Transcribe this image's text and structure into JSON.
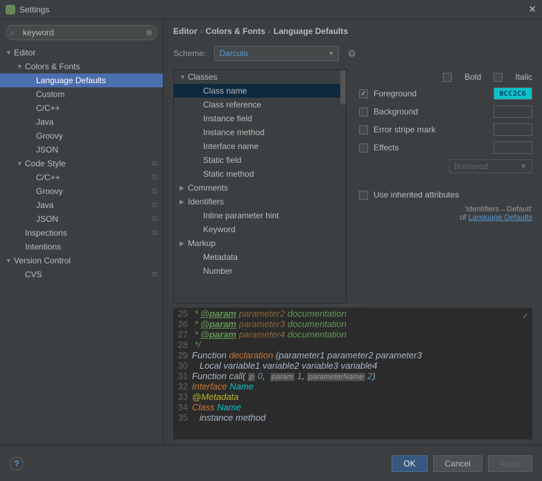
{
  "window": {
    "title": "Settings"
  },
  "search": {
    "value": "keyword"
  },
  "sidebar": {
    "items": [
      {
        "label": "Editor",
        "arrow": "▼",
        "indent": 0
      },
      {
        "label": "Colors & Fonts",
        "arrow": "▼",
        "indent": 1
      },
      {
        "label": "Language Defaults",
        "arrow": "",
        "indent": 2,
        "selected": true
      },
      {
        "label": "Custom",
        "arrow": "",
        "indent": 2
      },
      {
        "label": "C/C++",
        "arrow": "",
        "indent": 2
      },
      {
        "label": "Java",
        "arrow": "",
        "indent": 2
      },
      {
        "label": "Groovy",
        "arrow": "",
        "indent": 2
      },
      {
        "label": "JSON",
        "arrow": "",
        "indent": 2
      },
      {
        "label": "Code Style",
        "arrow": "▼",
        "indent": 1,
        "ext": "⧉"
      },
      {
        "label": "C/C++",
        "arrow": "",
        "indent": 2,
        "ext": "⧉"
      },
      {
        "label": "Groovy",
        "arrow": "",
        "indent": 2,
        "ext": "⧉"
      },
      {
        "label": "Java",
        "arrow": "",
        "indent": 2,
        "ext": "⧉"
      },
      {
        "label": "JSON",
        "arrow": "",
        "indent": 2,
        "ext": "⧉"
      },
      {
        "label": "Inspections",
        "arrow": "",
        "indent": 1,
        "ext": "⧉"
      },
      {
        "label": "Intentions",
        "arrow": "",
        "indent": 1
      },
      {
        "label": "Version Control",
        "arrow": "▼",
        "indent": 0
      },
      {
        "label": "CVS",
        "arrow": "",
        "indent": 1,
        "ext": "⧉"
      }
    ]
  },
  "breadcrumb": {
    "a": "Editor",
    "b": "Colors & Fonts",
    "c": "Language Defaults"
  },
  "scheme": {
    "label": "Scheme:",
    "value": "Darcula"
  },
  "attrs": {
    "items": [
      {
        "label": "Classes",
        "arrow": "▼"
      },
      {
        "label": "Class name",
        "sub": true,
        "sel": true
      },
      {
        "label": "Class reference",
        "sub": true
      },
      {
        "label": "Instance field",
        "sub": true
      },
      {
        "label": "Instance method",
        "sub": true
      },
      {
        "label": "Interface name",
        "sub": true
      },
      {
        "label": "Static field",
        "sub": true
      },
      {
        "label": "Static method",
        "sub": true
      },
      {
        "label": "Comments",
        "arrow": "▶"
      },
      {
        "label": "Identifiers",
        "arrow": "▶"
      },
      {
        "label": "Inline parameter hint",
        "sub": true
      },
      {
        "label": "Keyword",
        "sub": true
      },
      {
        "label": "Markup",
        "arrow": "▶"
      },
      {
        "label": "Metadata",
        "sub": true
      },
      {
        "label": "Number",
        "sub": true
      }
    ]
  },
  "props": {
    "bold": "Bold",
    "italic": "Italic",
    "foreground": "Foreground",
    "fg_value": "0CC2C6",
    "background": "Background",
    "errorstripe": "Error stripe mark",
    "effects": "Effects",
    "bordered": "Bordered",
    "useInherited": "Use inherited attributes",
    "inheritPath": "'Identifiers→Default'",
    "inheritOf": "of ",
    "inheritLink": "Language Defaults"
  },
  "preview": {
    "lines": [
      {
        "n": "25",
        "html": " * <span class='doctag'>@param</span> <span class='docparam'>parameter2</span> <span class='doc'>documentation</span>"
      },
      {
        "n": "26",
        "html": " * <span class='doctag'>@param</span> <span class='docparam'>parameter3</span> <span class='doc'>documentation</span>"
      },
      {
        "n": "27",
        "html": " * <span class='doctag'>@param</span> <span class='docparam'>parameter4</span> <span class='doc'>documentation</span>"
      },
      {
        "n": "28",
        "html": " */"
      },
      {
        "n": "29",
        "html": "<span class='txt'>Function </span><span class='kw'>declaration</span><span class='txt'> (parameter1 parameter2 parameter3</span>"
      },
      {
        "n": "30",
        "html": "<span class='txt'>   Local variable1 variable2 variable3 variable4</span>"
      },
      {
        "n": "31",
        "html": "<span class='txt'>Function call( </span><span class='paramname-bg'>p</span><span class='txt'> </span><span class='num'>0</span><span class='txt'>,  </span><span class='paramname-bg'>param</span><span class='txt'> </span><span class='num'>1</span><span class='txt'>, </span><span class='paramname-bg'>parameterName</span><span class='txt'> </span><span class='num'>2</span><span class='txt'>)</span>"
      },
      {
        "n": "32",
        "html": "<span class='kw'>Interface</span> <span class='cls'>Name</span>"
      },
      {
        "n": "33",
        "html": "<span class='meta'>@Metadata</span>"
      },
      {
        "n": "34",
        "html": "<span class='kw'>Class</span> <span class='cls'>Name</span>"
      },
      {
        "n": "35",
        "html": "<span class='txt'>   instance method</span>"
      }
    ]
  },
  "footer": {
    "ok": "OK",
    "cancel": "Cancel",
    "apply": "Apply"
  }
}
